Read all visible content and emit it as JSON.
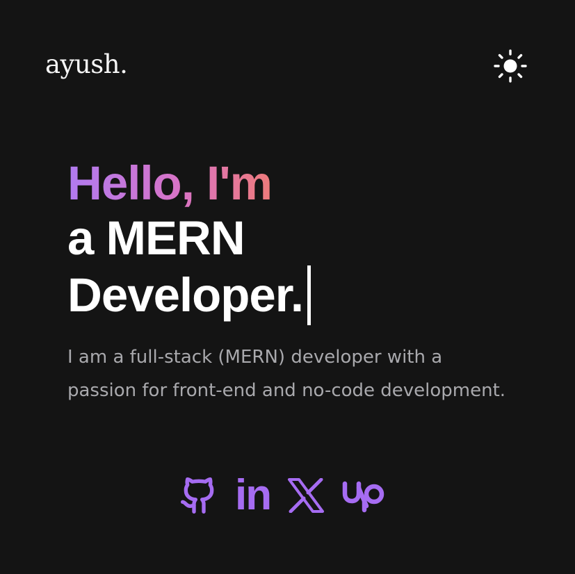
{
  "header": {
    "logo_text": "ayush.",
    "theme_toggle_icon": "sun-icon"
  },
  "hero": {
    "greeting": "Hello, I'm",
    "role_line_1": "a MERN",
    "role_line_2": "Developer.",
    "description": "I am a full-stack (MERN) developer with a passion for front-end and no-code development."
  },
  "socials": [
    {
      "name": "GitHub",
      "icon": "github-icon"
    },
    {
      "name": "LinkedIn",
      "icon": "linkedin-icon",
      "glyph": "in"
    },
    {
      "name": "X",
      "icon": "x-icon"
    },
    {
      "name": "Upwork",
      "icon": "upwork-icon"
    }
  ],
  "colors": {
    "background": "#141414",
    "accent_purple": "#a66cf2",
    "gradient_start": "#b07bf0",
    "gradient_end": "#ee7b7b",
    "text_primary": "#ffffff",
    "text_muted": "#a9a9ad"
  }
}
